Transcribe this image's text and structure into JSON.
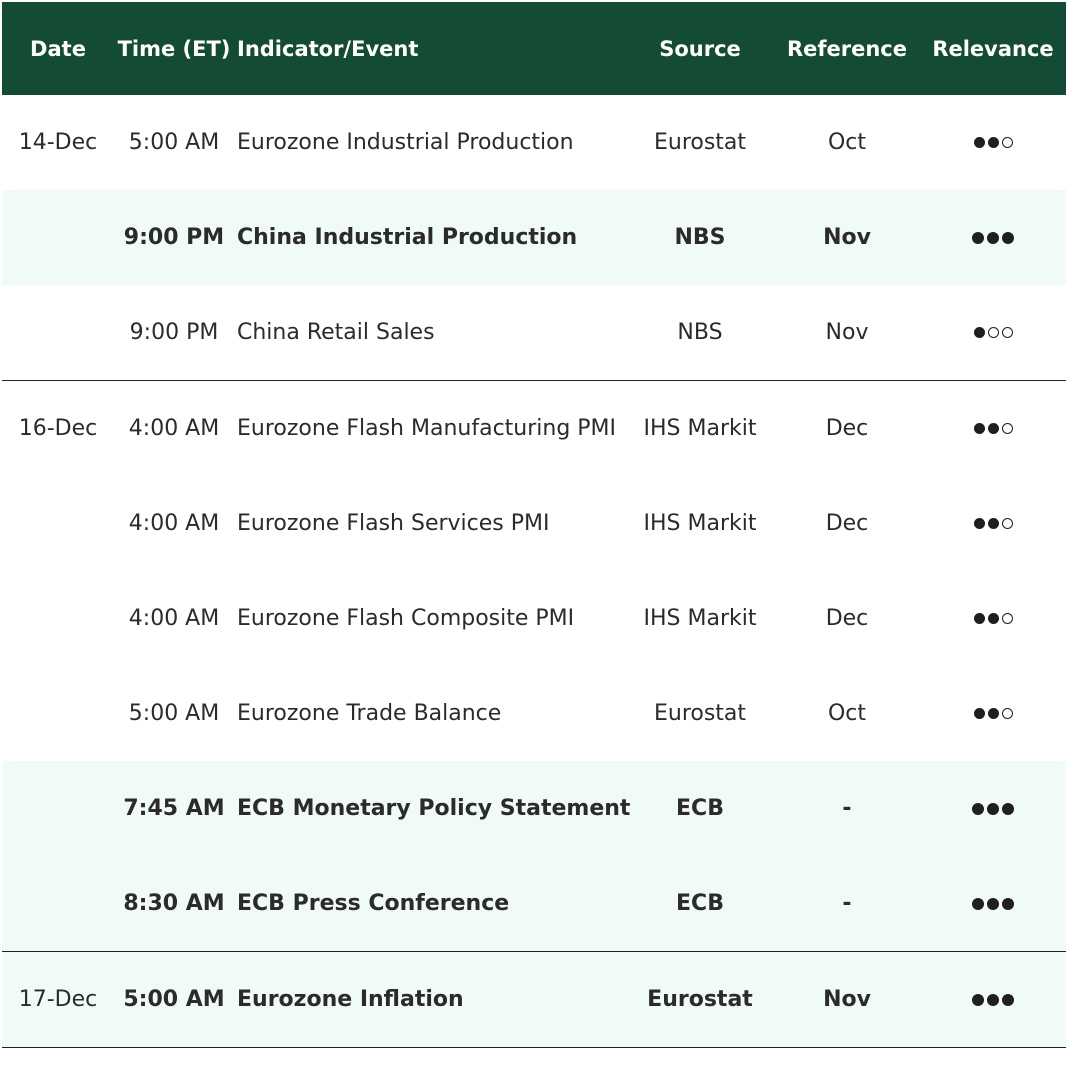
{
  "header": {
    "date": "Date",
    "time": "Time (ET)",
    "event": "Indicator/Event",
    "source": "Source",
    "reference": "Reference",
    "relevance": "Relevance"
  },
  "rows": [
    {
      "date": "14-Dec",
      "time": "5:00 AM",
      "event": "Eurozone Industrial Production",
      "source": "Eurostat",
      "reference": "Oct",
      "relevance": 2,
      "bold": false,
      "highlight": false,
      "group_end": false
    },
    {
      "date": "",
      "time": "9:00 PM",
      "event": "China Industrial Production",
      "source": "NBS",
      "reference": "Nov",
      "relevance": 3,
      "bold": true,
      "highlight": true,
      "group_end": false
    },
    {
      "date": "",
      "time": "9:00 PM",
      "event": "China Retail Sales",
      "source": "NBS",
      "reference": "Nov",
      "relevance": 1,
      "bold": false,
      "highlight": false,
      "group_end": true
    },
    {
      "date": "16-Dec",
      "time": "4:00 AM",
      "event": "Eurozone Flash Manufacturing PMI",
      "source": "IHS Markit",
      "reference": "Dec",
      "relevance": 2,
      "bold": false,
      "highlight": false,
      "group_end": false
    },
    {
      "date": "",
      "time": "4:00 AM",
      "event": "Eurozone Flash Services PMI",
      "source": "IHS Markit",
      "reference": "Dec",
      "relevance": 2,
      "bold": false,
      "highlight": false,
      "group_end": false
    },
    {
      "date": "",
      "time": "4:00 AM",
      "event": "Eurozone Flash Composite PMI",
      "source": "IHS Markit",
      "reference": "Dec",
      "relevance": 2,
      "bold": false,
      "highlight": false,
      "group_end": false
    },
    {
      "date": "",
      "time": "5:00 AM",
      "event": "Eurozone Trade Balance",
      "source": "Eurostat",
      "reference": "Oct",
      "relevance": 2,
      "bold": false,
      "highlight": false,
      "group_end": false
    },
    {
      "date": "",
      "time": "7:45 AM",
      "event": "ECB Monetary Policy Statement",
      "source": "ECB",
      "reference": "-",
      "relevance": 3,
      "bold": true,
      "highlight": true,
      "group_end": false
    },
    {
      "date": "",
      "time": "8:30 AM",
      "event": "ECB Press Conference",
      "source": "ECB",
      "reference": "-",
      "relevance": 3,
      "bold": true,
      "highlight": true,
      "group_end": true
    },
    {
      "date": "17-Dec",
      "time": "5:00 AM",
      "event": "Eurozone Inflation",
      "source": "Eurostat",
      "reference": "Nov",
      "relevance": 3,
      "bold": true,
      "highlight": true,
      "group_end": true
    }
  ],
  "relevance_max": 3,
  "colors": {
    "header_bg": "#144b35",
    "highlight_bg": "#f0fbf7",
    "text": "#2b2b2b"
  }
}
